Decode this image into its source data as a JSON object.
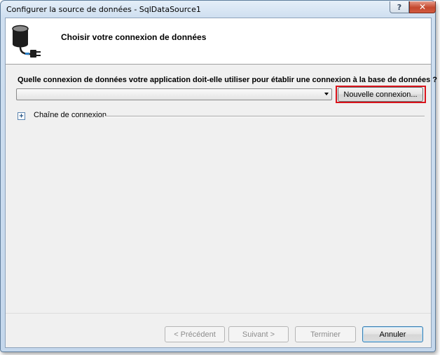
{
  "window": {
    "title": "Configurer la source de données - SqlDataSource1",
    "help_label": "?",
    "close_label": "✕"
  },
  "header": {
    "title": "Choisir votre connexion de données",
    "icon": "database-connection-icon"
  },
  "main": {
    "question": "Quelle connexion de données votre application doit-elle utiliser pour établir une connexion à la base de données ?",
    "connection_select_value": "",
    "new_connection_label": "Nouvelle connexion...",
    "connection_string_label": "Chaîne de connexion",
    "expander_symbol": "+"
  },
  "footer": {
    "previous_label": "< Précédent",
    "next_label": "Suivant >",
    "finish_label": "Terminer",
    "cancel_label": "Annuler"
  },
  "colors": {
    "highlight": "#d9131b",
    "title_gradient_top": "#e4eef8",
    "client_bg": "#f0f0f0"
  }
}
